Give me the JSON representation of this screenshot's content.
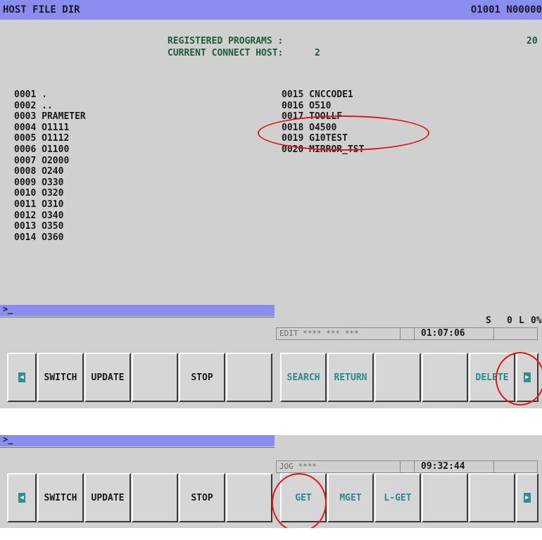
{
  "screen1": {
    "title": "HOST FILE DIR",
    "program_no": "O1001 N00000",
    "registered_label": "REGISTERED PROGRAMS :",
    "registered_value": "20",
    "host_label": "CURRENT CONNECT HOST:",
    "host_value": "2",
    "files_left": [
      "0001 .",
      "0002 ..",
      "0003 PRAMETER",
      "0004 O1111",
      "0005 O1112",
      "0006 O1100",
      "0007 O2000",
      "0008 O240",
      "0009 O330",
      "0010 O320",
      "0011 O310",
      "0012 O340",
      "0013 O350",
      "0014 O360"
    ],
    "files_right": [
      "0015 CNCCODE1",
      "0016 O510",
      "0017 TOOLLF",
      "0018 O4500",
      "0019 G10TEST",
      "0020 MIRROR_TST"
    ],
    "prompt": ">_",
    "spindle": "S",
    "spindle_value": "0",
    "load_label": "L",
    "load_value": "0%",
    "mode_text": "EDIT **** *** ***",
    "time": "01:07:06",
    "softkeys": [
      "",
      "SWITCH",
      "UPDATE",
      "",
      "STOP",
      "",
      "SEARCH",
      "RETURN",
      "",
      "",
      "DELETE",
      ""
    ]
  },
  "screen2": {
    "prompt": ">_",
    "mode_text": "JOG ****",
    "time": "09:32:44",
    "softkeys": [
      "",
      "SWITCH",
      "UPDATE",
      "",
      "STOP",
      "",
      "GET",
      "MGET",
      "L-GET",
      "",
      "",
      ""
    ]
  },
  "icons": {
    "prev_key": "left-arrow-icon",
    "next_key": "right-arrow-icon"
  },
  "colors": {
    "title_bar": "#8a8cf0",
    "screen_bg": "#d0d0d0",
    "highlight_text": "#2a8a8a",
    "annotation": "#e01818"
  }
}
